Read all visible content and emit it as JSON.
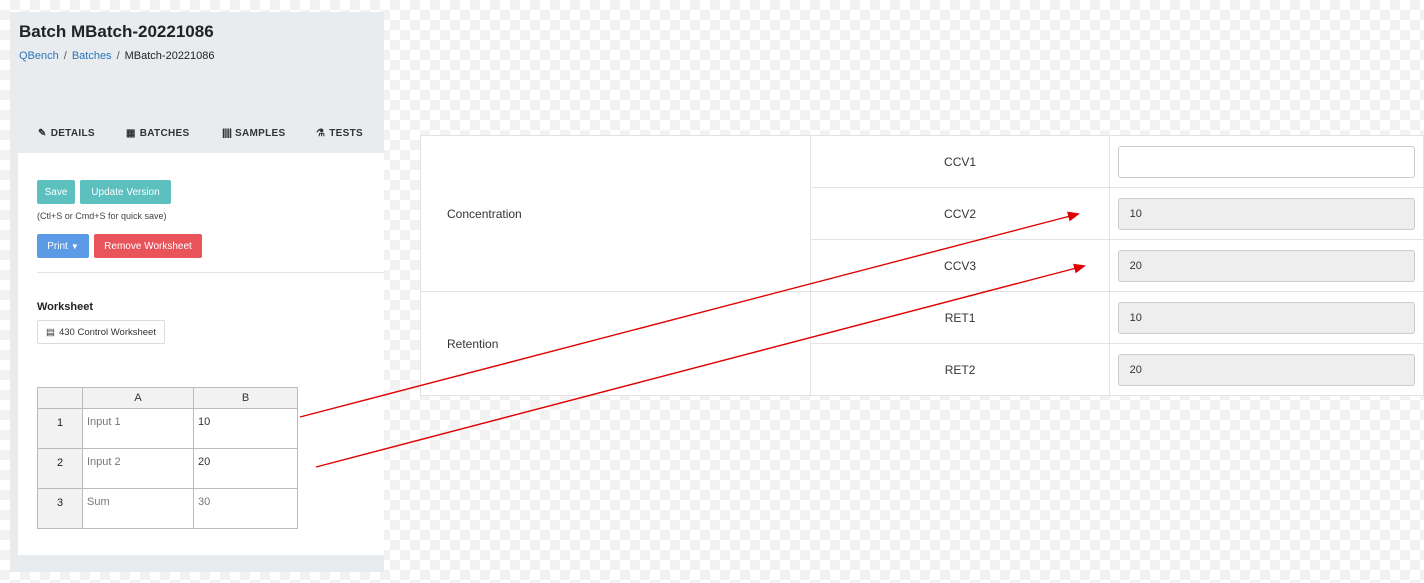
{
  "page": {
    "title": "Batch MBatch-20221086",
    "breadcrumb": [
      "QBench",
      "Batches",
      "MBatch-20221086"
    ]
  },
  "tabs": [
    {
      "label": "DETAILS",
      "icon": "pencil-icon"
    },
    {
      "label": "BATCHES",
      "icon": "grid-icon"
    },
    {
      "label": "SAMPLES",
      "icon": "barcode-icon"
    },
    {
      "label": "TESTS",
      "icon": "flask-icon"
    }
  ],
  "actions": {
    "save": "Save",
    "update_version": "Update Version",
    "quick_save_hint": "(Ctl+S or Cmd+S for quick save)",
    "print": "Print",
    "remove_worksheet": "Remove Worksheet"
  },
  "worksheet": {
    "label": "Worksheet",
    "name": "430  Control Worksheet",
    "columns": [
      "A",
      "B"
    ],
    "rows": [
      {
        "num": "1",
        "a": "Input 1",
        "b": "10"
      },
      {
        "num": "2",
        "a": "Input 2",
        "b": "20"
      },
      {
        "num": "3",
        "a": "Sum",
        "b": "30"
      }
    ]
  },
  "results": {
    "groups": [
      {
        "name": "Concentration",
        "fields": [
          {
            "key": "CCV1",
            "value": ""
          },
          {
            "key": "CCV2",
            "value": "10"
          },
          {
            "key": "CCV3",
            "value": "20"
          }
        ]
      },
      {
        "name": "Retention",
        "fields": [
          {
            "key": "RET1",
            "value": "10"
          },
          {
            "key": "RET2",
            "value": "20"
          }
        ]
      }
    ]
  },
  "colors": {
    "arrow": "#e00000",
    "teal": "#5bc0be",
    "blue": "#5b9be6",
    "red": "#e8545a"
  }
}
